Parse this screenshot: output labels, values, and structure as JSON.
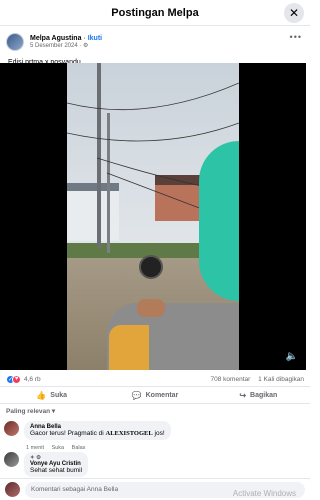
{
  "header": {
    "title": "Postingan Melpa",
    "close_icon": "✕"
  },
  "post": {
    "author": "Melpa Agustina",
    "separator": " · ",
    "follow_label": "Ikuti",
    "date": "5 Desember 2024",
    "dot": " · ",
    "privacy_icon": "⚙",
    "more_icon": "•••",
    "caption": "Edisi prtma x posyandu ."
  },
  "stats": {
    "reactions_count": "4,6 rb",
    "comments": "708 komentar",
    "shares": "1 Kali dibagikan"
  },
  "actions": {
    "like_icon": "👍",
    "like_label": "Suka",
    "comment_icon": "💬",
    "comment_label": "Komentar",
    "share_icon": "↪",
    "share_label": "Bagikan"
  },
  "sort": {
    "label": "Paling relevan",
    "chevron": "▾"
  },
  "comments": [
    {
      "name": "Anna Bella",
      "text_before": "Gacor terus! Pragmatic di ",
      "text_bold": "ALEXISTOGEL",
      "text_after": " jos!",
      "time": "1 menit",
      "like": "Suka",
      "reply": "Balas"
    },
    {
      "badge": "✦ ⚙",
      "name": "Vonye Ayu Cristin",
      "text": "Sehat sehat bumil"
    }
  ],
  "composer": {
    "placeholder": "Komentari sebagai Anna Bella"
  },
  "watermark": "Activate Windows",
  "video": {
    "volume_icon": "🔈"
  },
  "colors": {
    "brand": "#1877f2",
    "helmet": "#2cc3a6"
  }
}
